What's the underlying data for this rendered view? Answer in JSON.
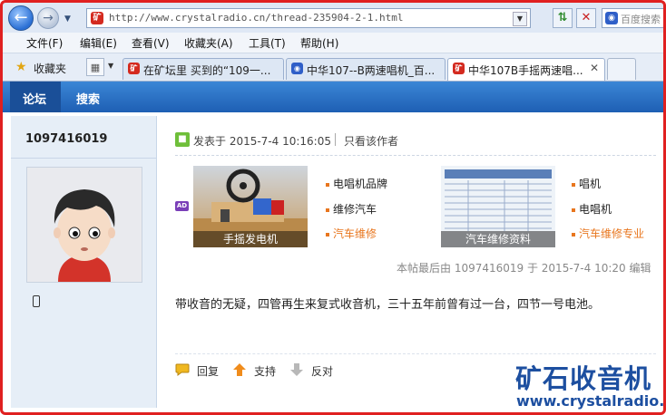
{
  "browser": {
    "url": "http://www.crystalradio.cn/thread-235904-2-1.html",
    "search_placeholder": "百度搜索",
    "site_icon_text": "矿",
    "menu": [
      "文件(F)",
      "编辑(E)",
      "查看(V)",
      "收藏夹(A)",
      "工具(T)",
      "帮助(H)"
    ],
    "favorites_label": "收藏夹",
    "tabs": [
      {
        "label": "在矿坛里 买到的“109一...",
        "active": false
      },
      {
        "label": "中华107--B两速唱机_百...",
        "active": false
      },
      {
        "label": "中华107B手摇两速唱...",
        "active": true
      }
    ]
  },
  "site_nav": [
    "论坛",
    "搜索"
  ],
  "sidebar": {
    "username": "1097416019"
  },
  "post": {
    "posted": "发表于 2015-7-4 10:16:05",
    "author_only": "只看该作者",
    "ad_badge": "AD",
    "ad_left": {
      "caption": "手摇发电机",
      "links": [
        "电唱机品牌",
        "维修汽车",
        "汽车维修"
      ]
    },
    "ad_right": {
      "caption": "汽车维修资料",
      "links": [
        "唱机",
        "电唱机",
        "汽车维修专业"
      ]
    },
    "edited": "本帖最后由 1097416019 于 2015-7-4 10:20 编辑",
    "content": "带收音的无疑，四管再生来复式收音机，三十五年前曾有过一台，四节一号电池。",
    "actions": [
      "回复",
      "支持",
      "反对"
    ]
  },
  "watermark": {
    "title": "矿石收音机",
    "url": "www.crystalradio.cn"
  }
}
